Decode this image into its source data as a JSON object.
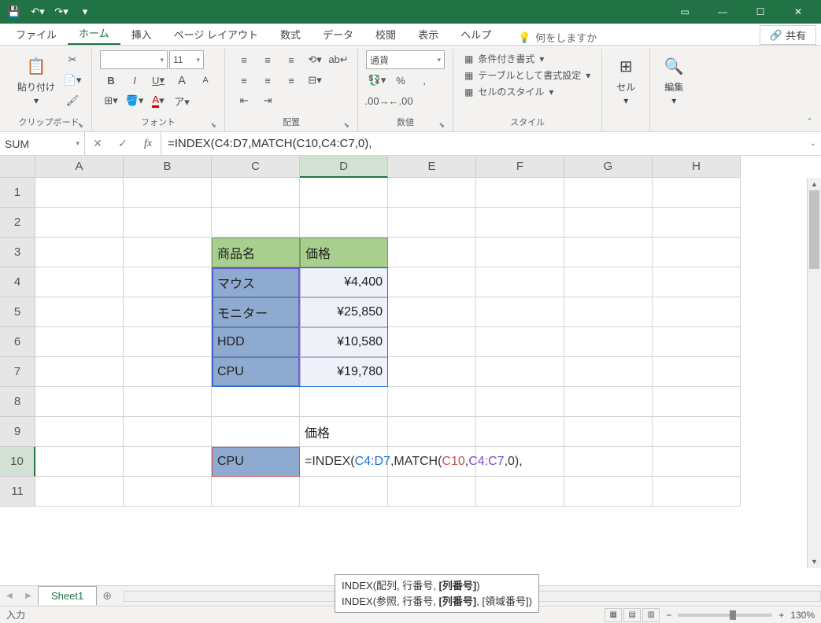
{
  "titlebar": {
    "save_icon": "💾",
    "undo_icon": "↶",
    "redo_icon": "↷"
  },
  "window": {
    "ribbon_mode": "▭",
    "min": "—",
    "max": "☐",
    "close": "✕"
  },
  "menu": {
    "file": "ファイル",
    "home": "ホーム",
    "insert": "挿入",
    "layout": "ページ レイアウト",
    "formulas": "数式",
    "data": "データ",
    "review": "校閲",
    "view": "表示",
    "help": "ヘルプ",
    "tellme": "何をしますか",
    "share": "共有"
  },
  "ribbon": {
    "clipboard": {
      "label": "クリップボード",
      "paste": "貼り付け"
    },
    "font": {
      "label": "フォント",
      "name": "",
      "size": "11",
      "bold": "B",
      "italic": "I",
      "underline": "U",
      "grow": "A",
      "shrink": "A"
    },
    "align": {
      "label": "配置"
    },
    "number": {
      "label": "数値",
      "format": "通貨"
    },
    "styles": {
      "label": "スタイル",
      "cond": "条件付き書式",
      "table": "テーブルとして書式設定",
      "cell": "セルのスタイル"
    },
    "cells": {
      "label": "セル"
    },
    "editing": {
      "label": "編集"
    }
  },
  "namebox": "SUM",
  "formula": "=INDEX(C4:D7,MATCH(C10,C4:C7,0),",
  "columns": [
    "A",
    "B",
    "C",
    "D",
    "E",
    "F",
    "G",
    "H"
  ],
  "rows": [
    "1",
    "2",
    "3",
    "4",
    "5",
    "6",
    "7",
    "8",
    "9",
    "10",
    "11"
  ],
  "sheet": {
    "c3": "商品名",
    "d3": "価格",
    "c4": "マウス",
    "d4": "¥4,400",
    "c5": "モニター",
    "d5": "¥25,850",
    "c6": "HDD",
    "d6": "¥10,580",
    "c7": "CPU",
    "d7": "¥19,780",
    "d9": "価格",
    "c10": "CPU",
    "d10_prefix": "=INDEX(",
    "d10_r1": "C4:D7",
    "d10_mid1": ",MATCH(",
    "d10_r2": "C10",
    "d10_mid2": ",",
    "d10_r3": "C4:C7",
    "d10_suffix": ",0),"
  },
  "tooltip": {
    "line1a": "INDEX(配列, 行番号, ",
    "line1b": "[列番号]",
    "line1c": ")",
    "line2a": "INDEX(参照, 行番号, ",
    "line2b": "[列番号]",
    "line2c": ", [領域番号])"
  },
  "tabs": {
    "sheet1": "Sheet1"
  },
  "status": {
    "mode": "入力",
    "zoom": "130%"
  }
}
